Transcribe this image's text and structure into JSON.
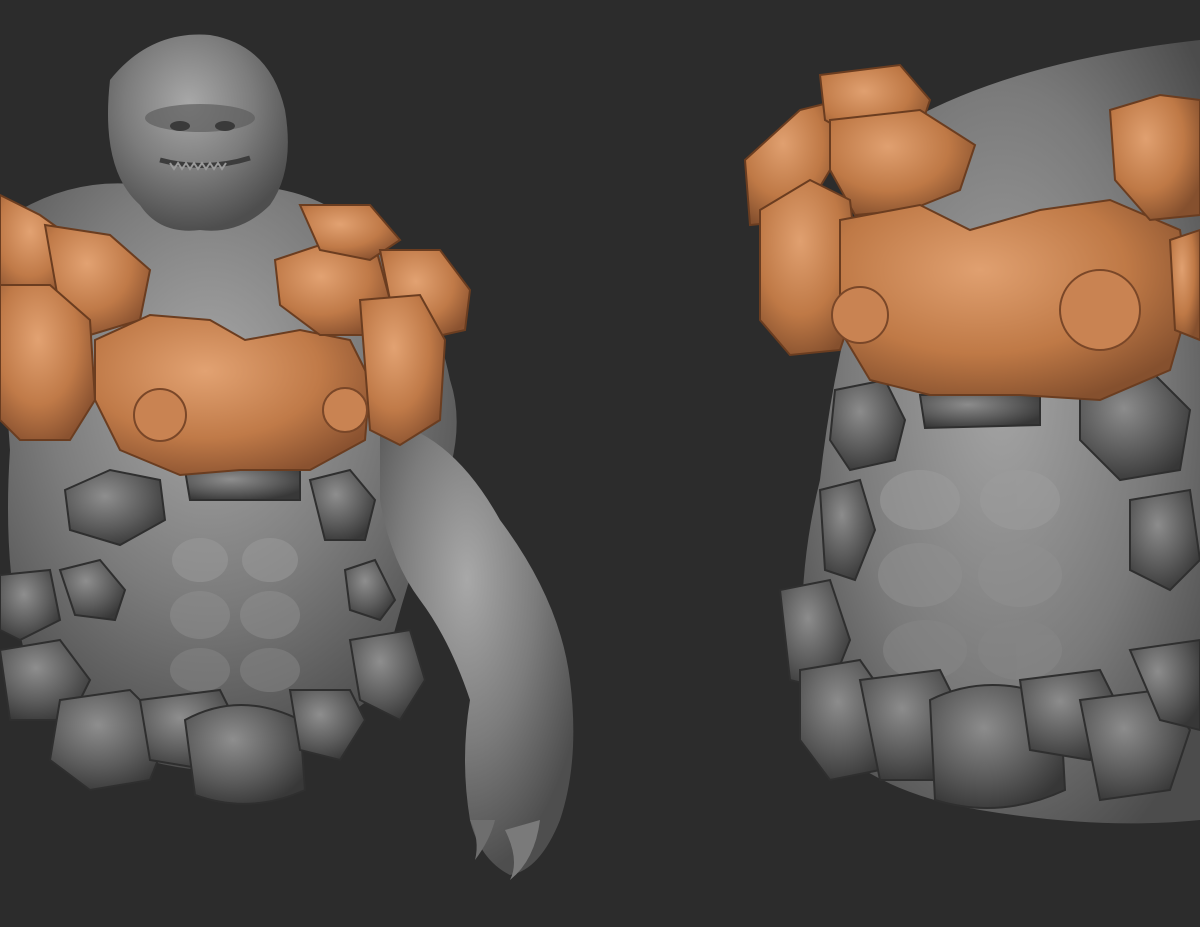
{
  "scene": {
    "background": "#2c2c2c",
    "skin_color": "#8a8a8a",
    "armor_color": "#c98352",
    "dark_armor_color": "#5a5a5a"
  },
  "views": [
    {
      "id": "left",
      "subject": "brute-bust-front-view"
    },
    {
      "id": "right",
      "subject": "brute-torso-closeup-view"
    }
  ]
}
